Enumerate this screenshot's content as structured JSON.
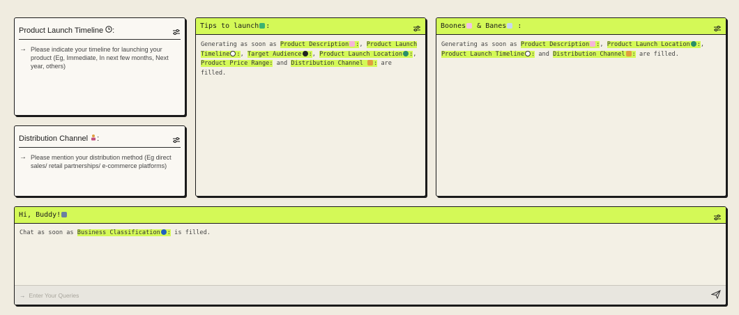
{
  "cards": {
    "timeline": {
      "title": "Product Launch Timeline",
      "hint": "Please indicate your timeline for launching your product (Eg, Immediate, In next few months, Next year, others)"
    },
    "distribution": {
      "title": "Distribution Channel",
      "hint": "Please mention your distribution method (Eg direct sales/ retail partnerships/ e-commerce platforms)"
    },
    "tips": {
      "title": "Tips to launch",
      "text": {
        "prefix": "Generating as soon as ",
        "f1": "Product Description",
        "f2": "Product Launch Timeline",
        "f3": "Target Audience",
        "f4": "Product Launch Location",
        "f5": "Product Price Range:",
        "and": "and",
        "f6": "Distribution Channel",
        "suffix": "are filled."
      }
    },
    "boones": {
      "title_a": "Boones",
      "title_b": "& Banes",
      "text": {
        "prefix": "Generating as soon as ",
        "f1": "Product Description",
        "f2": "Product Launch Location",
        "f3": "Product Launch Timeline",
        "and": "and",
        "f4": "Distribution Channel",
        "suffix": "are filled."
      }
    },
    "chat": {
      "title": "Hi, Buddy!",
      "prefix": "Chat as soon as ",
      "field": "Business Classification",
      "suffix": "is filled.",
      "placeholder": "Enter Your Queries"
    }
  },
  "colors": {
    "accent": "#d4f957",
    "background": "#f0ece0",
    "border": "#1a1a1a"
  },
  "icons": [
    "clock-icon",
    "person-icon",
    "check-icon",
    "chart-up-icon",
    "chart-down-icon",
    "sliders-icon",
    "arrow-right-icon",
    "send-icon",
    "globe-icon",
    "eyes-icon",
    "target-icon",
    "robot-icon"
  ]
}
